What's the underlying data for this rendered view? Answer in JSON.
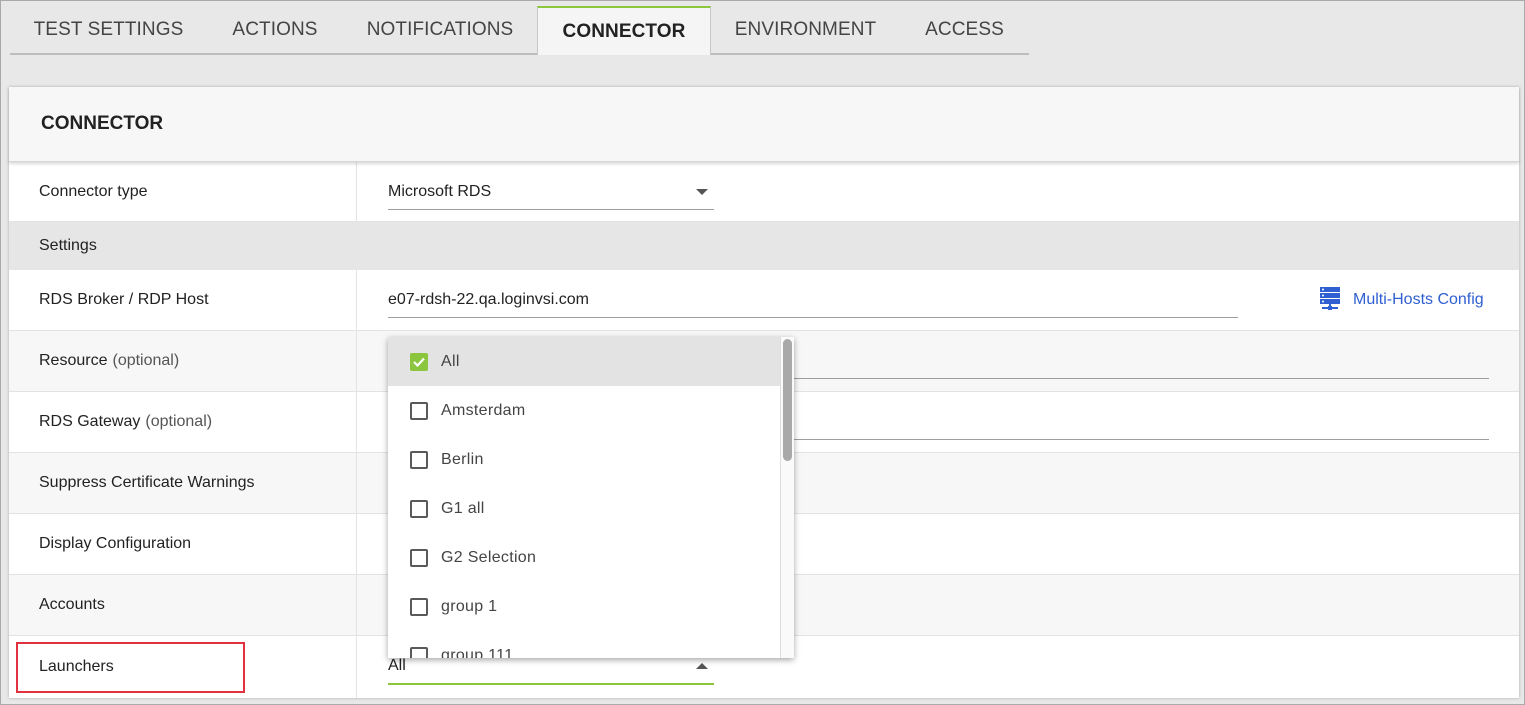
{
  "tabs": [
    {
      "label": "TEST SETTINGS"
    },
    {
      "label": "ACTIONS"
    },
    {
      "label": "NOTIFICATIONS"
    },
    {
      "label": "CONNECTOR"
    },
    {
      "label": "ENVIRONMENT"
    },
    {
      "label": "ACCESS"
    }
  ],
  "active_tab": "CONNECTOR",
  "panel": {
    "title": "CONNECTOR",
    "connector_type_label": "Connector type",
    "connector_type_value": "Microsoft RDS",
    "settings_label": "Settings",
    "rds_broker_label": "RDS Broker / RDP Host",
    "rds_broker_value": "e07-rdsh-22.qa.loginvsi.com",
    "multi_hosts_label": "Multi-Hosts Config",
    "resource_label": "Resource",
    "resource_optional": "(optional)",
    "gateway_label": "RDS Gateway",
    "gateway_optional": "(optional)",
    "suppress_label": "Suppress Certificate Warnings",
    "display_label": "Display Configuration",
    "accounts_label": "Accounts",
    "launchers_label": "Launchers",
    "launchers_value": "All"
  },
  "launcher_options": [
    {
      "label": "All",
      "checked": true
    },
    {
      "label": "Amsterdam",
      "checked": false
    },
    {
      "label": "Berlin",
      "checked": false
    },
    {
      "label": "G1 all",
      "checked": false
    },
    {
      "label": "G2 Selection",
      "checked": false
    },
    {
      "label": "group 1",
      "checked": false
    },
    {
      "label": "group 111",
      "checked": false
    }
  ],
  "colors": {
    "accent_green": "#8cc63f",
    "link_blue": "#2f5fd0",
    "highlight_red": "#e2313f"
  }
}
